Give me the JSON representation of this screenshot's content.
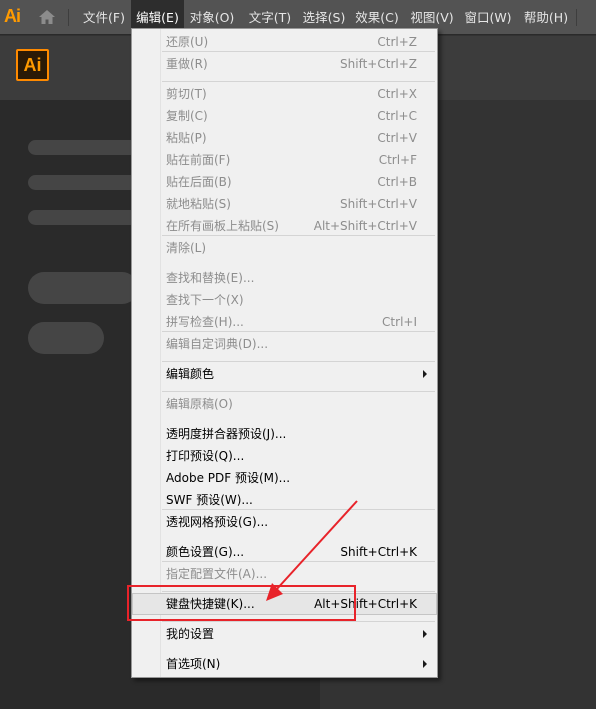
{
  "app": {
    "logo_small": "Ai",
    "logo": "Ai",
    "home_icon": "home-icon"
  },
  "menubar": {
    "items": [
      {
        "label": "文件(F)"
      },
      {
        "label": "编辑(E)"
      },
      {
        "label": "对象(O)"
      },
      {
        "label": "文字(T)"
      },
      {
        "label": "选择(S)"
      },
      {
        "label": "效果(C)"
      },
      {
        "label": "视图(V)"
      },
      {
        "label": "窗口(W)"
      },
      {
        "label": "帮助(H)"
      }
    ],
    "active_index": 1
  },
  "edit_menu": {
    "items": [
      {
        "label": "还原(U)",
        "shortcut": "Ctrl+Z",
        "enabled": false
      },
      {
        "label": "重做(R)",
        "shortcut": "Shift+Ctrl+Z",
        "enabled": false
      },
      {
        "label": "剪切(T)",
        "shortcut": "Ctrl+X",
        "enabled": false
      },
      {
        "label": "复制(C)",
        "shortcut": "Ctrl+C",
        "enabled": false
      },
      {
        "label": "粘贴(P)",
        "shortcut": "Ctrl+V",
        "enabled": false
      },
      {
        "label": "贴在前面(F)",
        "shortcut": "Ctrl+F",
        "enabled": false
      },
      {
        "label": "贴在后面(B)",
        "shortcut": "Ctrl+B",
        "enabled": false
      },
      {
        "label": "就地粘贴(S)",
        "shortcut": "Shift+Ctrl+V",
        "enabled": false
      },
      {
        "label": "在所有画板上粘贴(S)",
        "shortcut": "Alt+Shift+Ctrl+V",
        "enabled": false
      },
      {
        "label": "清除(L)",
        "shortcut": "",
        "enabled": false
      },
      {
        "label": "查找和替换(E)...",
        "shortcut": "",
        "enabled": false
      },
      {
        "label": "查找下一个(X)",
        "shortcut": "",
        "enabled": false
      },
      {
        "label": "拼写检查(H)...",
        "shortcut": "Ctrl+I",
        "enabled": false
      },
      {
        "label": "编辑自定词典(D)...",
        "shortcut": "",
        "enabled": false
      },
      {
        "label": "编辑颜色",
        "shortcut": "",
        "enabled": true,
        "submenu": true
      },
      {
        "label": "编辑原稿(O)",
        "shortcut": "",
        "enabled": false
      },
      {
        "label": "透明度拼合器预设(J)...",
        "shortcut": "",
        "enabled": true
      },
      {
        "label": "打印预设(Q)...",
        "shortcut": "",
        "enabled": true
      },
      {
        "label": "Adobe PDF 预设(M)...",
        "shortcut": "",
        "enabled": true
      },
      {
        "label": "SWF 预设(W)...",
        "shortcut": "",
        "enabled": true
      },
      {
        "label": "透视网格预设(G)...",
        "shortcut": "",
        "enabled": true
      },
      {
        "label": "颜色设置(G)...",
        "shortcut": "Shift+Ctrl+K",
        "enabled": true
      },
      {
        "label": "指定配置文件(A)...",
        "shortcut": "",
        "enabled": false
      },
      {
        "label": "键盘快捷键(K)...",
        "shortcut": "Alt+Shift+Ctrl+K",
        "enabled": true,
        "highlighted": true
      },
      {
        "label": "我的设置",
        "shortcut": "",
        "enabled": true,
        "submenu": true
      },
      {
        "label": "首选项(N)",
        "shortcut": "",
        "enabled": true,
        "submenu": true
      }
    ]
  },
  "colors": {
    "menubar_bg": "#535353",
    "menu_bg": "#f0f0f0",
    "disabled_text": "#8d8d8d",
    "logo_orange": "#ff9a00",
    "annotation_red": "#e8232a"
  }
}
